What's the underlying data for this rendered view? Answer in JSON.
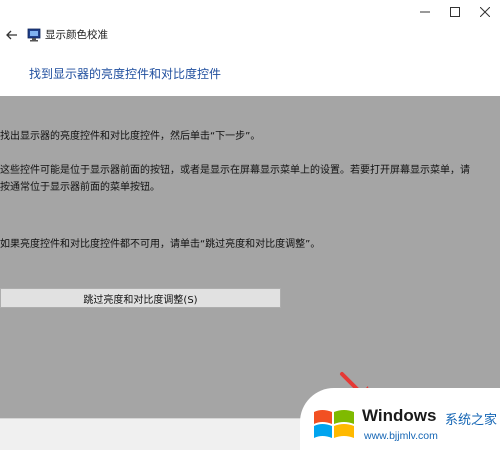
{
  "window": {
    "app_title": "显示颜色校准",
    "controls": {
      "minimize_icon": "minimize-icon",
      "maximize_icon": "maximize-icon",
      "close_icon": "close-icon"
    }
  },
  "page": {
    "heading": "找到显示器的亮度控件和对比度控件",
    "paragraph1": "找出显示器的亮度控件和对比度控件，然后单击“下一步”。",
    "paragraph2": "这些控件可能是位于显示器前面的按钮，或者是显示在屏幕显示菜单上的设置。若要打开屏幕显示菜单，请按通常位于显示器前面的菜单按钮。",
    "paragraph3": "如果亮度控件和对比度控件都不可用，请单击“跳过亮度和对比度调整”。",
    "skip_button": "跳过亮度和对比度调整(S)"
  },
  "colors": {
    "panel_bg": "#a5a5a5",
    "heading": "#1f4e9e",
    "watermark_blue": "#1566b5",
    "arrow": "#e53935"
  },
  "watermark": {
    "brand": "Windows",
    "brand_cn": "系统之家",
    "url": "www.bjjmlv.com"
  }
}
